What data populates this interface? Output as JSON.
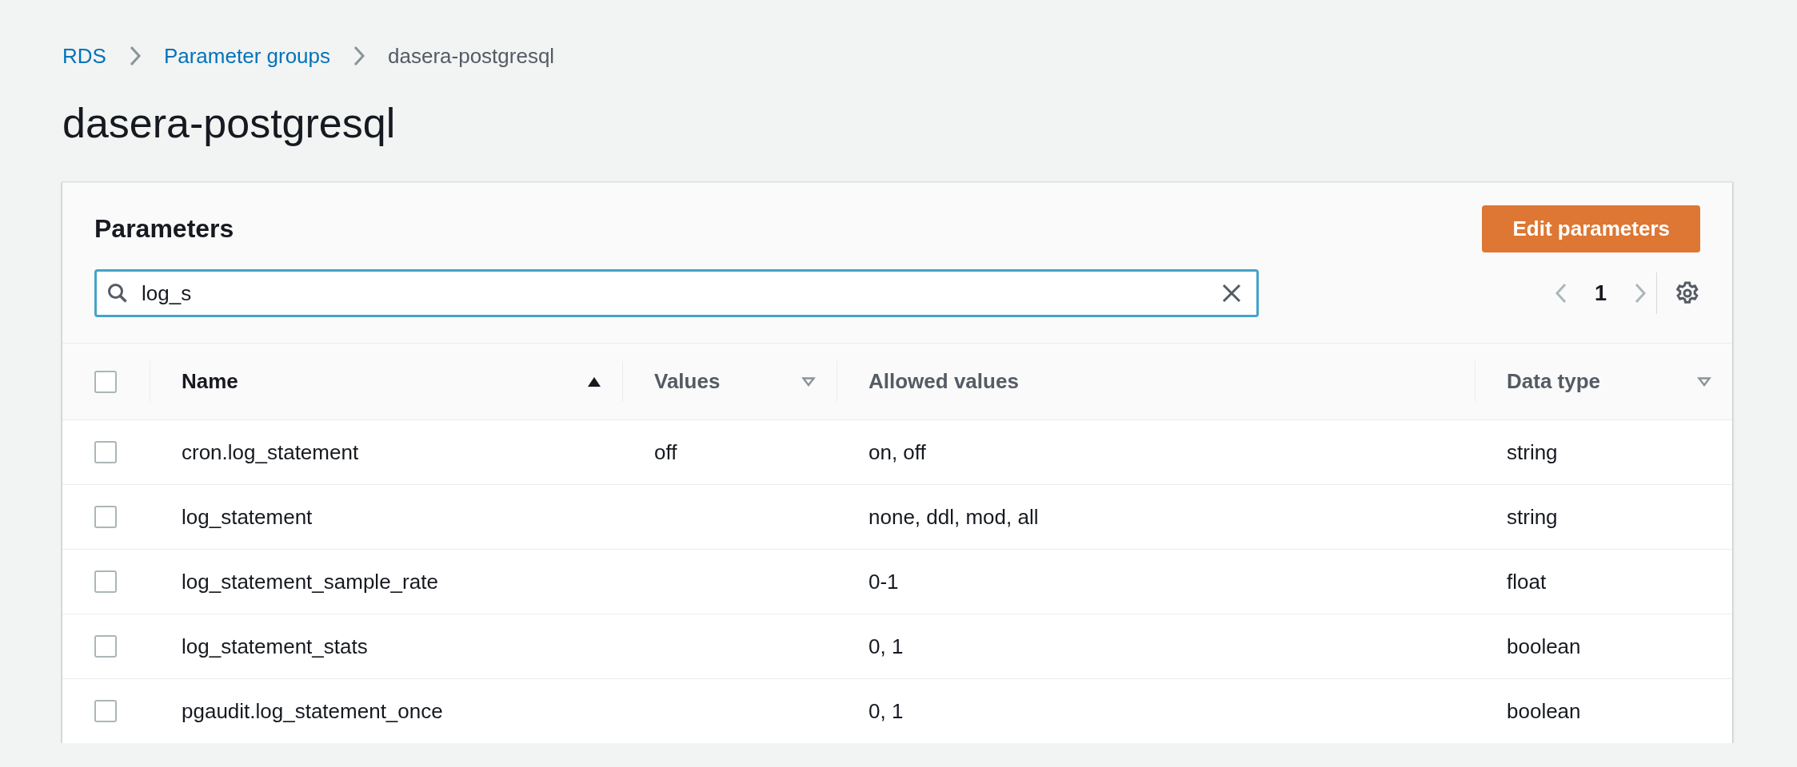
{
  "breadcrumbs": [
    {
      "label": "RDS",
      "kind": "link"
    },
    {
      "label": "Parameter groups",
      "kind": "link"
    },
    {
      "label": "dasera-postgresql",
      "kind": "current"
    }
  ],
  "page_title": "dasera-postgresql",
  "panel": {
    "title": "Parameters",
    "action_button": "Edit parameters",
    "search": {
      "value": "log_s"
    },
    "pagination": {
      "page": "1",
      "prev_disabled": true,
      "next_disabled": true
    },
    "table": {
      "select_all_checked": false,
      "columns": [
        {
          "label": "Name",
          "sortable": true,
          "sorted": true
        },
        {
          "label": "Values",
          "sortable": true,
          "sorted": false
        },
        {
          "label": "Allowed values",
          "sortable": false
        },
        {
          "label": "Data type",
          "sortable": true,
          "sorted": false
        }
      ],
      "rows": [
        {
          "checked": false,
          "cells": [
            "cron.log_statement",
            "off",
            "on, off",
            "string"
          ]
        },
        {
          "checked": false,
          "cells": [
            "log_statement",
            "",
            "none, ddl, mod, all",
            "string"
          ]
        },
        {
          "checked": false,
          "cells": [
            "log_statement_sample_rate",
            "",
            "0-1",
            "float"
          ]
        },
        {
          "checked": false,
          "cells": [
            "log_statement_stats",
            "",
            "0, 1",
            "boolean"
          ]
        },
        {
          "checked": false,
          "cells": [
            "pgaudit.log_statement_once",
            "",
            "0, 1",
            "boolean"
          ]
        }
      ]
    }
  }
}
